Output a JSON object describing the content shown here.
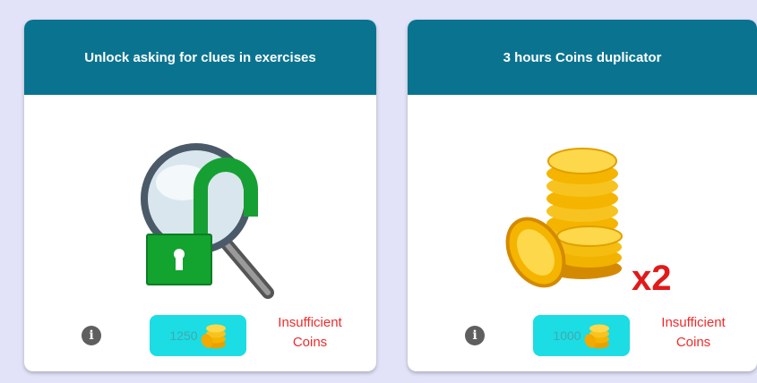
{
  "cards": [
    {
      "title": "Unlock asking for clues in exercises",
      "price": "1250",
      "status_line1": "Insufficient",
      "status_line2": "Coins",
      "image_icon": "magnifier-unlock-icon"
    },
    {
      "title": "3 hours Coins duplicator",
      "price": "1000",
      "status_line1": "Insufficient",
      "status_line2": "Coins",
      "image_icon": "coin-stack-x2-icon",
      "multiplier": "x2"
    }
  ],
  "colors": {
    "background": "#e2e3f8",
    "header": "#0a7490",
    "price_pill": "#1bdde3",
    "status": "#f02b2b",
    "coin": "#f5b400"
  }
}
